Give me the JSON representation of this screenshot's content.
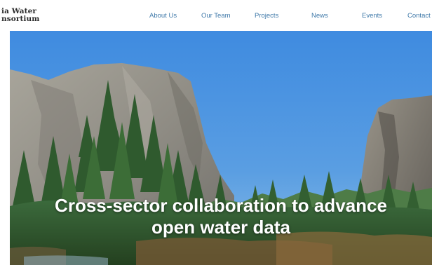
{
  "brand": {
    "line1": "ia Water",
    "line2": "nsortium"
  },
  "nav": {
    "items": [
      {
        "label": "About Us"
      },
      {
        "label": "Our Team"
      },
      {
        "label": "Projects"
      },
      {
        "label": "News"
      },
      {
        "label": "Events"
      },
      {
        "label": "Contact"
      }
    ]
  },
  "hero": {
    "line1": "Cross-sector collaboration to advance",
    "line2": "open water data"
  },
  "colors": {
    "nav_link": "#3f79a9",
    "sky": "#3b86d9",
    "hero_text": "#ffffff"
  }
}
